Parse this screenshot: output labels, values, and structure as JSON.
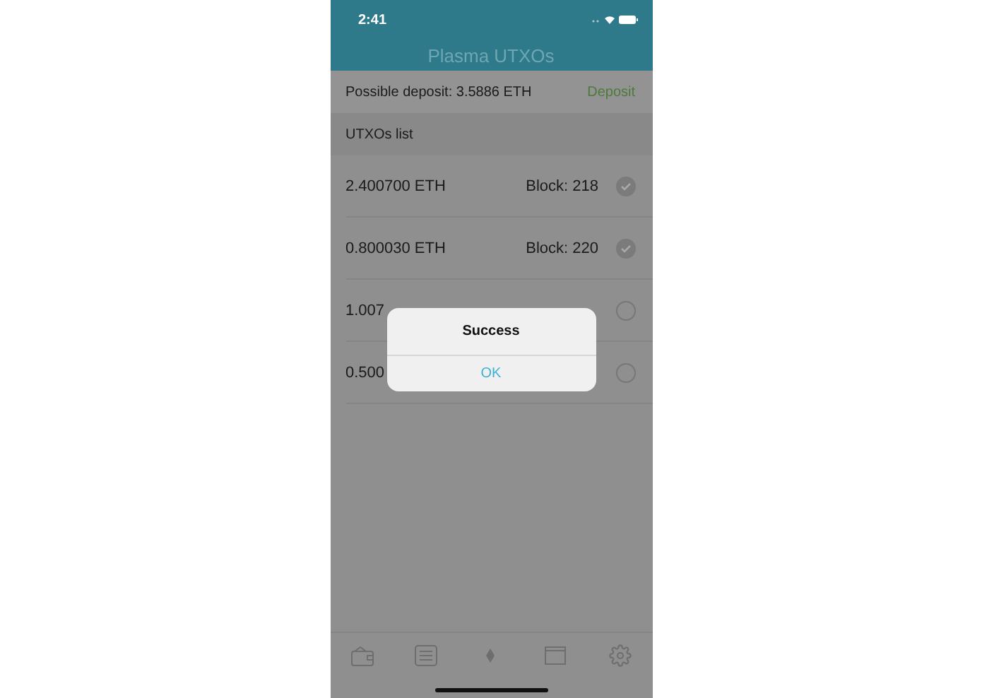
{
  "status_bar": {
    "time": "2:41"
  },
  "nav": {
    "title": "Plasma UTXOs"
  },
  "deposit": {
    "label": "Possible deposit: 3.5886 ETH",
    "action": "Deposit"
  },
  "section": {
    "title": "UTXOs list"
  },
  "utxos": [
    {
      "amount": "2.400700 ETH",
      "block": "Block: 218",
      "checked": true
    },
    {
      "amount": "0.800030 ETH",
      "block": "Block: 220",
      "checked": true
    },
    {
      "amount": "1.007",
      "checked": false
    },
    {
      "amount": "0.500",
      "checked": false
    }
  ],
  "alert": {
    "title": "Success",
    "button": "OK"
  },
  "tab_bar": {
    "tabs": [
      {
        "kind": "wallet",
        "selected": false
      },
      {
        "kind": "list",
        "selected": false
      },
      {
        "kind": "ether",
        "selected": false
      },
      {
        "kind": "browser",
        "selected": false
      },
      {
        "kind": "settings",
        "selected": false
      }
    ]
  }
}
